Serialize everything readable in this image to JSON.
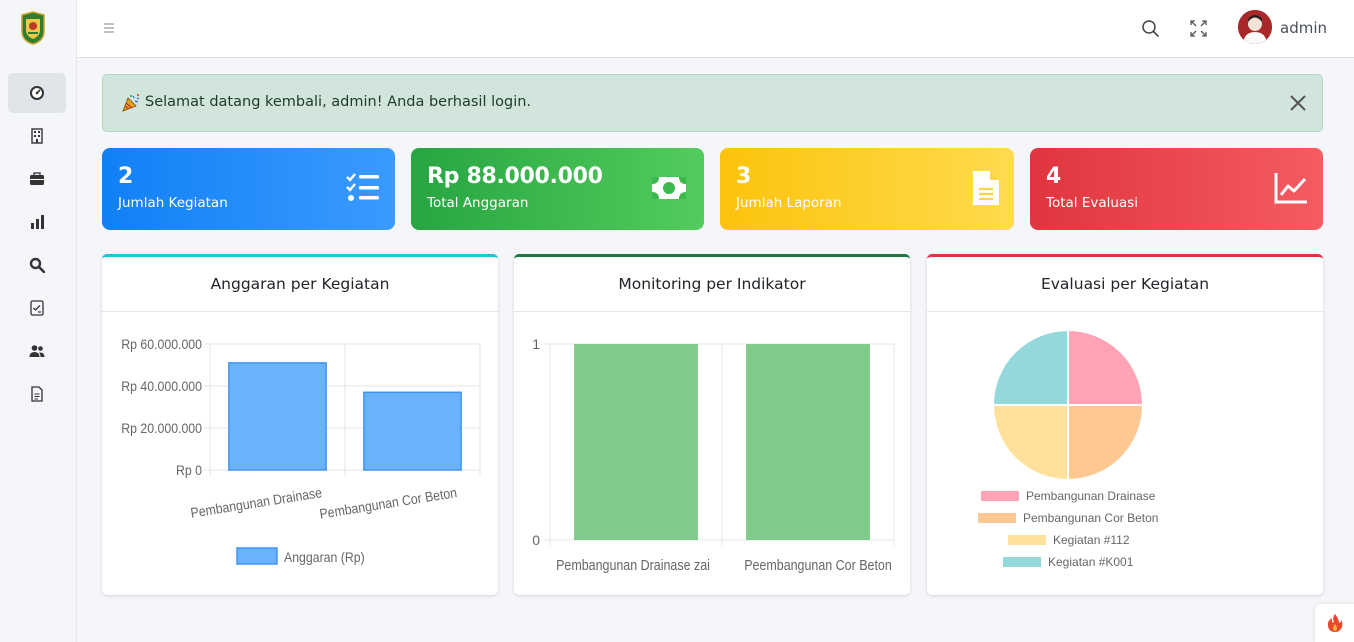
{
  "topbar": {
    "user_name": "admin"
  },
  "alert": {
    "message": "Selamat datang kembali, admin! Anda berhasil login."
  },
  "stats": [
    {
      "value": "2",
      "label": "Jumlah Kegiatan",
      "icon": "list-check-icon",
      "color": "#1180f6"
    },
    {
      "value": "Rp 88.000.000",
      "label": "Total Anggaran",
      "icon": "money-bill-icon",
      "color": "#28a745"
    },
    {
      "value": "3",
      "label": "Jumlah Laporan",
      "icon": "file-icon",
      "color": "#ffc107"
    },
    {
      "value": "4",
      "label": "Total Evaluasi",
      "icon": "chart-line-icon",
      "color": "#dc3545"
    }
  ],
  "sidebar": {
    "items": [
      {
        "icon": "dashboard-gauge-icon",
        "active": true
      },
      {
        "icon": "building-icon"
      },
      {
        "icon": "briefcase-icon"
      },
      {
        "icon": "bar-chart-icon"
      },
      {
        "icon": "search-icon"
      },
      {
        "icon": "checklist-icon"
      },
      {
        "icon": "users-icon"
      },
      {
        "icon": "document-icon"
      }
    ]
  },
  "cards": {
    "anggaran": {
      "title": "Anggaran per Kegiatan"
    },
    "monitoring": {
      "title": "Monitoring per Indikator"
    },
    "evaluasi": {
      "title": "Evaluasi per Kegiatan"
    }
  },
  "chart_data": [
    {
      "type": "bar",
      "title": "Anggaran per Kegiatan",
      "categories": [
        "Pembangunan Drainase",
        "Pembangunan Cor Beton"
      ],
      "series": [
        {
          "name": "Anggaran (Rp)",
          "values": [
            51000000,
            37000000
          ],
          "color": "#63aefc"
        }
      ],
      "yticks": [
        "Rp 0",
        "Rp 20.000.000",
        "Rp 40.000.000",
        "Rp 60.000.000"
      ],
      "ylim": [
        0,
        60000000
      ],
      "legend": "bottom"
    },
    {
      "type": "bar",
      "title": "Monitoring per Indikator",
      "categories": [
        "Pembangunan Drainase zai",
        "Peembangunan Cor Beton"
      ],
      "series": [
        {
          "values": [
            1,
            1
          ],
          "color": "#80cb8b"
        }
      ],
      "yticks": [
        "0",
        "1"
      ],
      "ylim": [
        0,
        1
      ]
    },
    {
      "type": "pie",
      "title": "Evaluasi per Kegiatan",
      "labels": [
        "Pembangunan Drainase",
        "Pembangunan Cor Beton",
        "Kegiatan #112",
        "Kegiatan #K001"
      ],
      "values": [
        1,
        1,
        1,
        1
      ],
      "colors": [
        "#ffa3b5",
        "#ffc792",
        "#ffe19c",
        "#95d8dc"
      ],
      "legend": "bottom"
    }
  ]
}
